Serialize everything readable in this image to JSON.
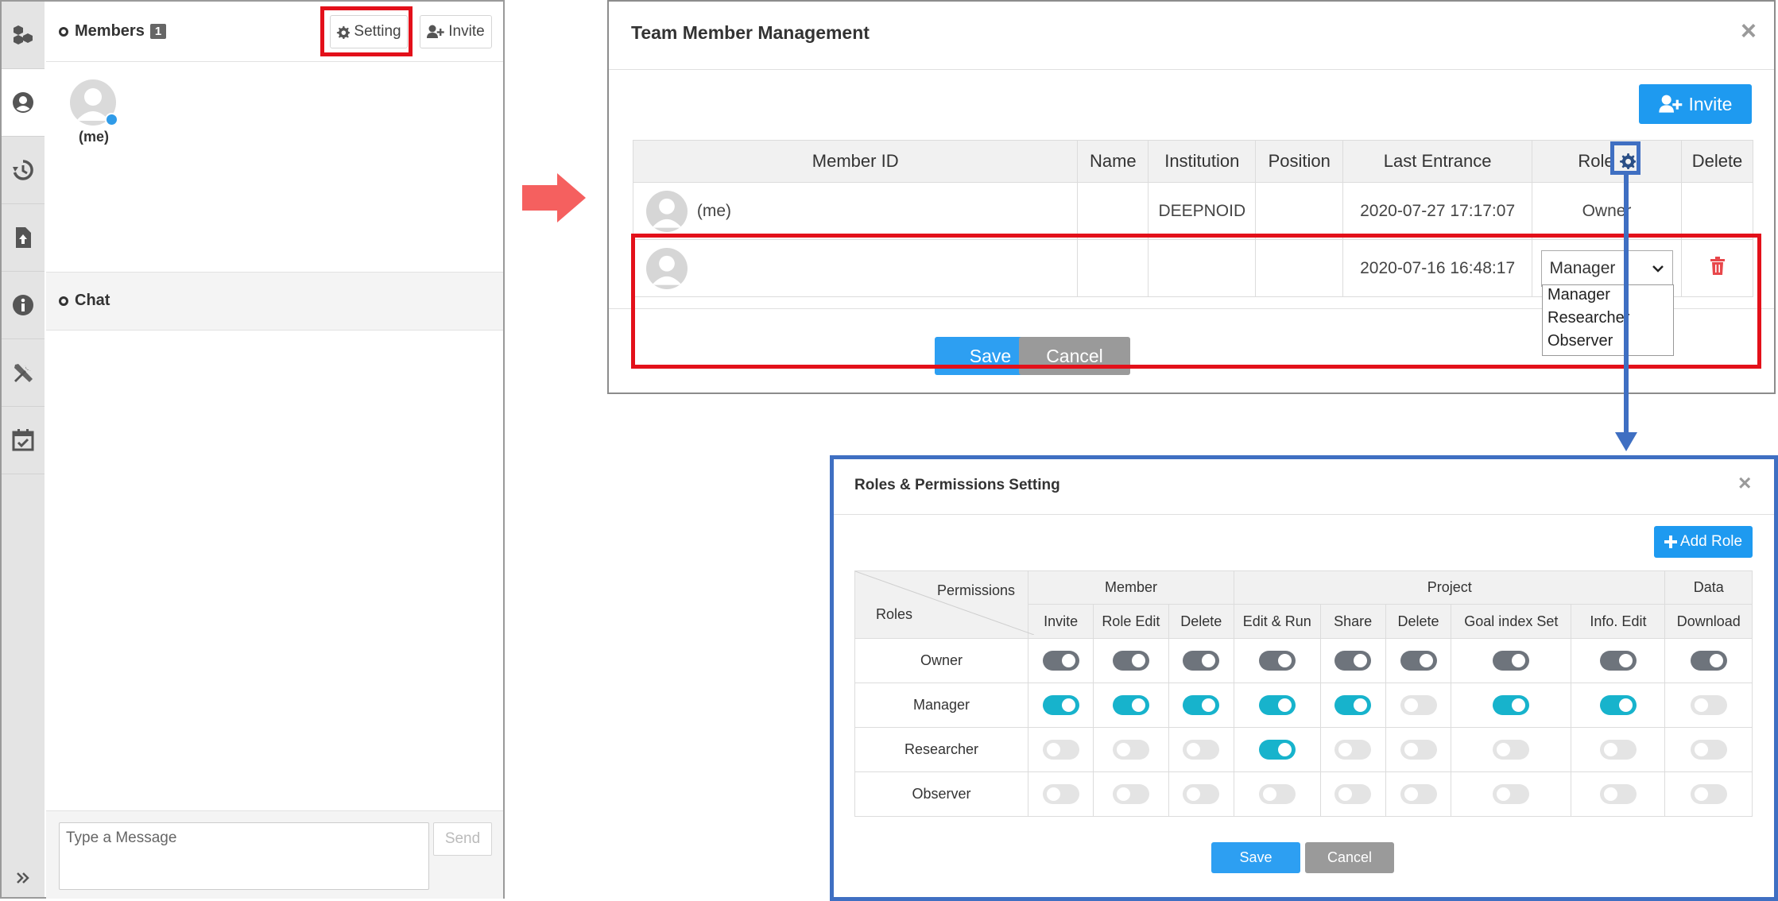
{
  "left_panel": {
    "rail_icons": [
      "cubes-icon",
      "user-circle-icon",
      "history-icon",
      "file-upload-icon",
      "info-icon",
      "tools-icon",
      "calendar-check-icon"
    ],
    "expand_icon": "double-chevron-right-icon",
    "members_title": "Members",
    "members_count": "1",
    "setting_label": "Setting",
    "invite_label": "Invite",
    "me_label": "(me)",
    "chat_title": "Chat",
    "message_placeholder": "Type a Message",
    "send_label": "Send"
  },
  "team_modal": {
    "title": "Team Member Management",
    "close": "×",
    "invite_label": "Invite",
    "columns": [
      "Member ID",
      "Name",
      "Institution",
      "Position",
      "Last Entrance",
      "Role",
      "Delete"
    ],
    "rows": [
      {
        "member_id": "(me)",
        "name": "",
        "institution": "DEEPNOID",
        "position": "",
        "last_entrance": "2020-07-27 17:17:07",
        "role": "Owner"
      },
      {
        "member_id": "",
        "name": "",
        "institution": "",
        "position": "",
        "last_entrance": "2020-07-16 16:48:17",
        "role": "Manager"
      }
    ],
    "role_options": [
      "Manager",
      "Researcher",
      "Observer"
    ],
    "save_label": "Save",
    "cancel_label": "Cancel"
  },
  "roles_modal": {
    "title": "Roles & Permissions Setting",
    "close": "×",
    "add_role_label": "Add Role",
    "corner_top": "Permissions",
    "corner_bottom": "Roles",
    "groups": [
      "Member",
      "Project",
      "Data"
    ],
    "permissions": [
      "Invite",
      "Role Edit",
      "Delete",
      "Edit & Run",
      "Share",
      "Delete",
      "Goal index Set",
      "Info. Edit",
      "Download"
    ],
    "roles": [
      {
        "name": "Owner",
        "toggles": [
          true,
          true,
          true,
          true,
          true,
          true,
          true,
          true,
          true
        ]
      },
      {
        "name": "Manager",
        "toggles": [
          true,
          true,
          true,
          true,
          true,
          false,
          true,
          true,
          false
        ]
      },
      {
        "name": "Researcher",
        "toggles": [
          false,
          false,
          false,
          true,
          false,
          false,
          false,
          false,
          false
        ]
      },
      {
        "name": "Observer",
        "toggles": [
          false,
          false,
          false,
          false,
          false,
          false,
          false,
          false,
          false
        ]
      }
    ],
    "save_label": "Save",
    "cancel_label": "Cancel"
  },
  "colors": {
    "highlight_red": "#e3101a",
    "highlight_blue": "#3f6fc2",
    "primary_blue": "#1e9af0",
    "owner_toggle": "#6e747c",
    "active_toggle": "#17b3cc",
    "delete_red": "#e8474b",
    "arrow_coral": "#f5605f"
  }
}
